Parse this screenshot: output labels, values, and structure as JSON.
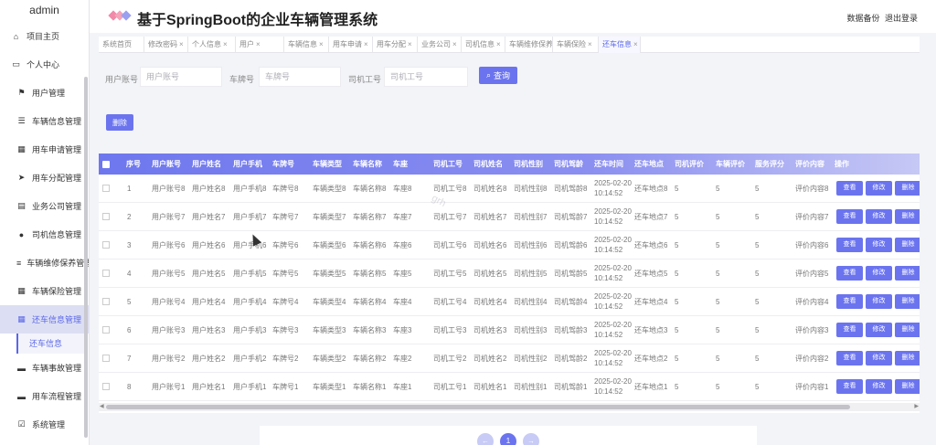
{
  "sidebar": {
    "user": "admin",
    "items": [
      {
        "label": "项目主页",
        "icon": "home-icon",
        "glyph": "⌂"
      },
      {
        "label": "个人中心",
        "icon": "profile-icon",
        "glyph": "▭"
      },
      {
        "label": "用户管理",
        "icon": "flag-icon",
        "glyph": "⚑"
      },
      {
        "label": "车辆信息管理",
        "icon": "list-icon",
        "glyph": "☰"
      },
      {
        "label": "用车申请管理",
        "icon": "grid-icon",
        "glyph": "▦"
      },
      {
        "label": "用车分配管理",
        "icon": "send-icon",
        "glyph": "➤"
      },
      {
        "label": "业务公司管理",
        "icon": "chart-icon",
        "glyph": "▤"
      },
      {
        "label": "司机信息管理",
        "icon": "person-icon",
        "glyph": "●"
      },
      {
        "label": "车辆维修保养管理",
        "icon": "sliders-icon",
        "glyph": "≡"
      },
      {
        "label": "车辆保险管理",
        "icon": "grid-icon",
        "glyph": "▦"
      },
      {
        "label": "还车信息管理",
        "icon": "grid-icon",
        "glyph": "▦"
      },
      {
        "label": "车辆事故管理",
        "icon": "monitor-icon",
        "glyph": "▬"
      },
      {
        "label": "用车流程管理",
        "icon": "monitor-icon",
        "glyph": "▬"
      },
      {
        "label": "系统管理",
        "icon": "check-icon",
        "glyph": "☑"
      }
    ],
    "active_submenu": "还车信息"
  },
  "header": {
    "title": "基于SpringBoot的企业车辆管理系统",
    "backup": "数据备份",
    "logout": "退出登录",
    "logo_colors": [
      "#f08aa8",
      "#f4a3b8",
      "#9aa0f0"
    ]
  },
  "tabs": [
    {
      "label": "系统首页",
      "close": ""
    },
    {
      "label": "修改密码",
      "close": "×"
    },
    {
      "label": "个人信息",
      "close": "×"
    },
    {
      "label": "用户",
      "close": "×"
    },
    {
      "label": "车辆信息",
      "close": "×"
    },
    {
      "label": "用车申请",
      "close": "×"
    },
    {
      "label": "用车分配",
      "close": "×"
    },
    {
      "label": "业务公司",
      "close": "×"
    },
    {
      "label": "司机信息",
      "close": "×"
    },
    {
      "label": "车辆维修保养",
      "close": ""
    },
    {
      "label": "车辆保险",
      "close": "×"
    },
    {
      "label": "还车信息",
      "close": "×"
    }
  ],
  "search": {
    "user_account_label": "用户账号",
    "user_account_placeholder": "用户账号",
    "plate_label": "车牌号",
    "plate_placeholder": "车牌号",
    "driver_id_label": "司机工号",
    "driver_id_placeholder": "司机工号",
    "search_button": "查询",
    "search_icon": "search-icon"
  },
  "toolbar": {
    "delete_button": "删除"
  },
  "table": {
    "columns": [
      "序号",
      "用户账号",
      "用户姓名",
      "用户手机",
      "车牌号",
      "车辆类型",
      "车辆名称",
      "车座",
      "司机工号",
      "司机姓名",
      "司机性别",
      "司机驾龄",
      "还车时间",
      "还车地点",
      "司机评价",
      "车辆评价",
      "服务评分",
      "评价内容",
      "操作"
    ],
    "rows": [
      {
        "no": "1",
        "c": [
          "用户账号8",
          "用户姓名8",
          "用户手机8",
          "车牌号8",
          "车辆类型8",
          "车辆名称8",
          "车座8",
          "司机工号8",
          "司机姓名8",
          "司机性别8",
          "司机驾龄8",
          "2025-02-20 10:14:52",
          "还车地点8",
          "5",
          "5",
          "5",
          "评价内容8"
        ]
      },
      {
        "no": "2",
        "c": [
          "用户账号7",
          "用户姓名7",
          "用户手机7",
          "车牌号7",
          "车辆类型7",
          "车辆名称7",
          "车座7",
          "司机工号7",
          "司机姓名7",
          "司机性别7",
          "司机驾龄7",
          "2025-02-20 10:14:52",
          "还车地点7",
          "5",
          "5",
          "5",
          "评价内容7"
        ]
      },
      {
        "no": "3",
        "c": [
          "用户账号6",
          "用户姓名6",
          "用户手机6",
          "车牌号6",
          "车辆类型6",
          "车辆名称6",
          "车座6",
          "司机工号6",
          "司机姓名6",
          "司机性别6",
          "司机驾龄6",
          "2025-02-20 10:14:52",
          "还车地点6",
          "5",
          "5",
          "5",
          "评价内容6"
        ]
      },
      {
        "no": "4",
        "c": [
          "用户账号5",
          "用户姓名5",
          "用户手机5",
          "车牌号5",
          "车辆类型5",
          "车辆名称5",
          "车座5",
          "司机工号5",
          "司机姓名5",
          "司机性别5",
          "司机驾龄5",
          "2025-02-20 10:14:52",
          "还车地点5",
          "5",
          "5",
          "5",
          "评价内容5"
        ]
      },
      {
        "no": "5",
        "c": [
          "用户账号4",
          "用户姓名4",
          "用户手机4",
          "车牌号4",
          "车辆类型4",
          "车辆名称4",
          "车座4",
          "司机工号4",
          "司机姓名4",
          "司机性别4",
          "司机驾龄4",
          "2025-02-20 10:14:52",
          "还车地点4",
          "5",
          "5",
          "5",
          "评价内容4"
        ]
      },
      {
        "no": "6",
        "c": [
          "用户账号3",
          "用户姓名3",
          "用户手机3",
          "车牌号3",
          "车辆类型3",
          "车辆名称3",
          "车座3",
          "司机工号3",
          "司机姓名3",
          "司机性别3",
          "司机驾龄3",
          "2025-02-20 10:14:52",
          "还车地点3",
          "5",
          "5",
          "5",
          "评价内容3"
        ]
      },
      {
        "no": "7",
        "c": [
          "用户账号2",
          "用户姓名2",
          "用户手机2",
          "车牌号2",
          "车辆类型2",
          "车辆名称2",
          "车座2",
          "司机工号2",
          "司机姓名2",
          "司机性别2",
          "司机驾龄2",
          "2025-02-20 10:14:52",
          "还车地点2",
          "5",
          "5",
          "5",
          "评价内容2"
        ]
      },
      {
        "no": "8",
        "c": [
          "用户账号1",
          "用户姓名1",
          "用户手机1",
          "车牌号1",
          "车辆类型1",
          "车辆名称1",
          "车座1",
          "司机工号1",
          "司机姓名1",
          "司机性别1",
          "司机驾龄1",
          "2025-02-20 10:14:52",
          "还车地点1",
          "5",
          "5",
          "5",
          "评价内容1"
        ]
      }
    ],
    "actions": [
      "查看",
      "修改",
      "删除"
    ]
  },
  "pagination": {
    "prev": "←",
    "current": "1",
    "next": "→"
  },
  "colors": {
    "accent": "#6b74ee",
    "pager_disabled": "#c7cbf5"
  }
}
